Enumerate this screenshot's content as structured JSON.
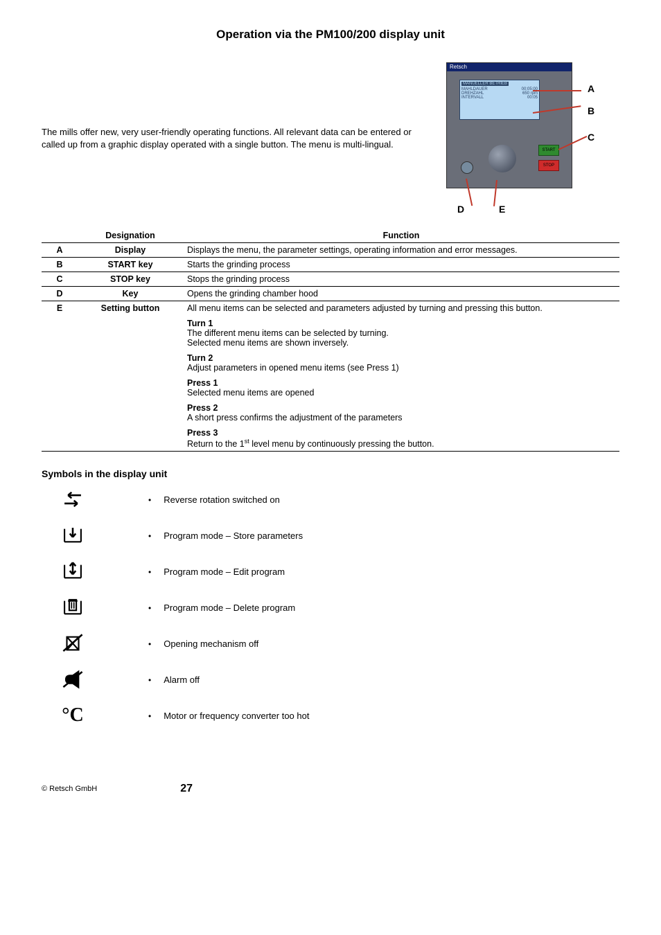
{
  "title": "Operation via the PM100/200 display unit",
  "intro": "The mills offer new, very user-friendly operating functions. All relevant data can be entered or called up from a graphic display operated with a single button. The menu is multi-lingual.",
  "device": {
    "brand": "Retsch",
    "screen_header": "MANUELLER BETRIEB",
    "screen_rows": [
      {
        "l": "MAHLDAUER",
        "r": "00:05:00"
      },
      {
        "l": "DREHZAHL",
        "r": "650 rpm"
      },
      {
        "l": "INTERVALL",
        "r": "00:05"
      }
    ],
    "start": "START",
    "stop": "STOP"
  },
  "labels": {
    "A": "A",
    "B": "B",
    "C": "C",
    "D": "D",
    "E": "E"
  },
  "table": {
    "headers": {
      "designation": "Designation",
      "function": "Function"
    },
    "rows": [
      {
        "id": "A",
        "designation": "Display",
        "function": "Displays the menu, the parameter settings, operating information and error messages."
      },
      {
        "id": "B",
        "designation": "START key",
        "function": "Starts the grinding process"
      },
      {
        "id": "C",
        "designation": "STOP key",
        "function": "Stops the grinding process"
      },
      {
        "id": "D",
        "designation": "Key",
        "function": "Opens the grinding chamber hood"
      },
      {
        "id": "E",
        "designation": "Setting button",
        "function_intro": "All menu items can be selected and parameters adjusted by turning and pressing this button.",
        "blocks": [
          {
            "h": "Turn 1",
            "t": "The different menu items can be selected by turning.\nSelected menu items are shown inversely."
          },
          {
            "h": "Turn 2",
            "t": "Adjust parameters in opened menu items (see Press 1)"
          },
          {
            "h": "Press 1",
            "t": "Selected menu items are opened"
          },
          {
            "h": "Press 2",
            "t": "A short press confirms the adjustment of the parameters"
          },
          {
            "h": "Press 3",
            "t_pre": "Return to the 1",
            "t_sup": "st",
            "t_post": " level menu by continuously pressing the button."
          }
        ]
      }
    ]
  },
  "symbols_heading": "Symbols in the display unit",
  "symbols": [
    {
      "name": "reverse-rotation-icon",
      "text": "Reverse rotation switched on"
    },
    {
      "name": "store-parameters-icon",
      "text": "Program mode – Store parameters"
    },
    {
      "name": "edit-program-icon",
      "text": "Program mode – Edit program"
    },
    {
      "name": "delete-program-icon",
      "text": "Program mode – Delete program"
    },
    {
      "name": "opening-mechanism-off-icon",
      "text": "Opening mechanism off"
    },
    {
      "name": "alarm-off-icon",
      "text": "Alarm off"
    },
    {
      "name": "temperature-icon",
      "text": "Motor or frequency converter too hot"
    }
  ],
  "footer": {
    "copyright": "© Retsch GmbH",
    "page": "27"
  }
}
